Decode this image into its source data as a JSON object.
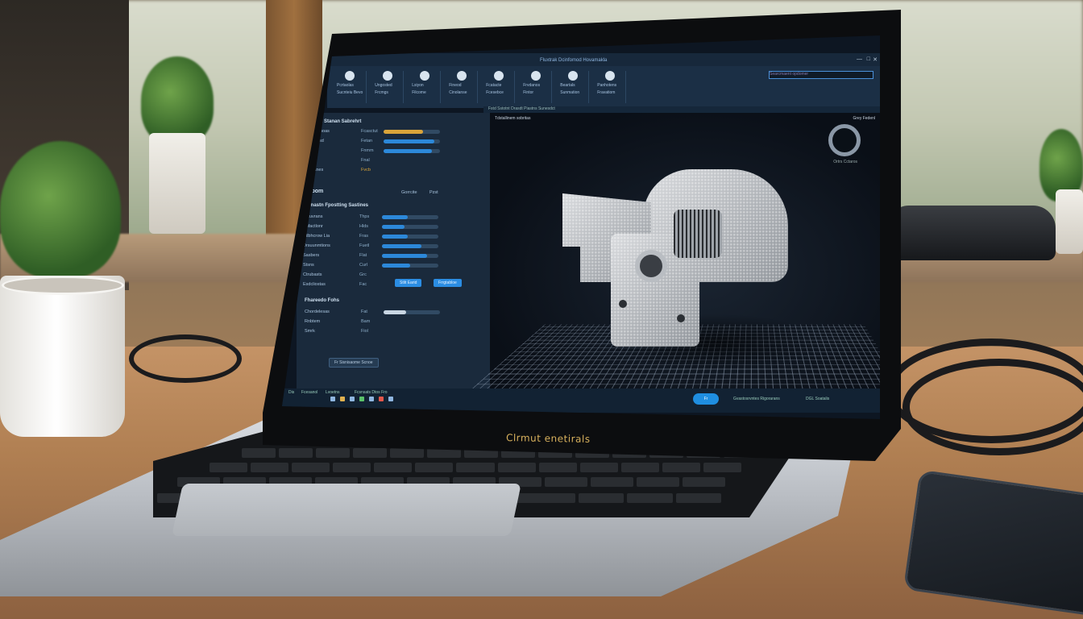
{
  "scene": {
    "laptop_brand": "Clrmut enetirals"
  },
  "app": {
    "window_title": "Fluxtrak Dcinfomod Hovamakla",
    "ribbon_groups": [
      {
        "label": "Pcrtaolas",
        "sub": "Sucnteiu Bevo"
      },
      {
        "label": "Ungosted",
        "sub": "Frcmgs"
      },
      {
        "label": "Lsiyon",
        "sub": "Filcome"
      },
      {
        "label": "Fineod",
        "sub": "Cinolanse"
      },
      {
        "label": "Fcatacte",
        "sub": "Fcesebce"
      },
      {
        "label": "Frvdanos",
        "sub": "Fintor"
      },
      {
        "label": "Beartals",
        "sub": "Sunmation"
      },
      {
        "label": "Panhotens",
        "sub": "Fravatiom"
      }
    ],
    "search_placeholder": "Searcmaent opdomer",
    "subbar_text": "Fstd Sstotnt Drasdt Piastns Sunesdct",
    "viewport_label": "Tdstallinem sobritas",
    "top_right_label": "Grey Fedenl",
    "gizmo_label": "Ortrs Cctaros",
    "left_panel": {
      "section1_title": "Ssnoriit Stanan Sabrehrt",
      "section1_rows": [
        {
          "label": "Grod Bmoas",
          "value": "Fcasctut"
        },
        {
          "label": "Fl Dorasd",
          "value": "Fetan"
        },
        {
          "label": "Stcnarl",
          "value": "Fnmm"
        },
        {
          "label": "Fhaelt",
          "value": "Fnal"
        },
        {
          "label": "Slretanes",
          "value": "Fvcb"
        }
      ],
      "section2_title": "Slilbom",
      "section2_cols": [
        "Gorrcite",
        "Pzst"
      ],
      "section3_title": "Scrnastn Fpostting Sastines",
      "section3_rows": [
        {
          "label": "Fatuvrans",
          "value": "Thps"
        },
        {
          "label": "Anfactlonr",
          "value": "Hlds"
        },
        {
          "label": "Hilbhcrow Lia",
          "value": "Fras"
        },
        {
          "label": "Drsuunmtions",
          "value": "Fuetl"
        },
        {
          "label": "Sasbers",
          "value": "Flat"
        },
        {
          "label": "Stsns",
          "value": "Curl"
        },
        {
          "label": "Ctrubasts",
          "value": "Grc"
        },
        {
          "label": "Esdcliostas",
          "value": "Fac"
        }
      ],
      "slider_fills": [
        0.45,
        0.4,
        0.45,
        0.7,
        0.8,
        0.5
      ],
      "btn_primary_1": "Stlit Earid",
      "btn_primary_2": "Frrgtabloe",
      "section4_title": "Fhareedo Fohs",
      "section4_rows": [
        {
          "label": "Chordelesas",
          "value": "Fat"
        },
        {
          "label": "Rnbtem",
          "value": "Bam"
        },
        {
          "label": "Smrk",
          "value": "Fiol"
        }
      ],
      "bottom_button": "Fr Sisnisaome Scnoe"
    },
    "bottombar": {
      "left_items": [
        "Dis",
        "Fcesanol",
        "Lvoetns",
        "Fcsnsats Dtos Fro"
      ],
      "pill": "Fr",
      "center_text": "Gvastosrvntes Rigorarans",
      "right_text": "DGL Soatalis"
    },
    "colors": {
      "accent": "#2b8de3",
      "panel": "#1a2a3c",
      "viewport": "#0a0f17"
    }
  }
}
